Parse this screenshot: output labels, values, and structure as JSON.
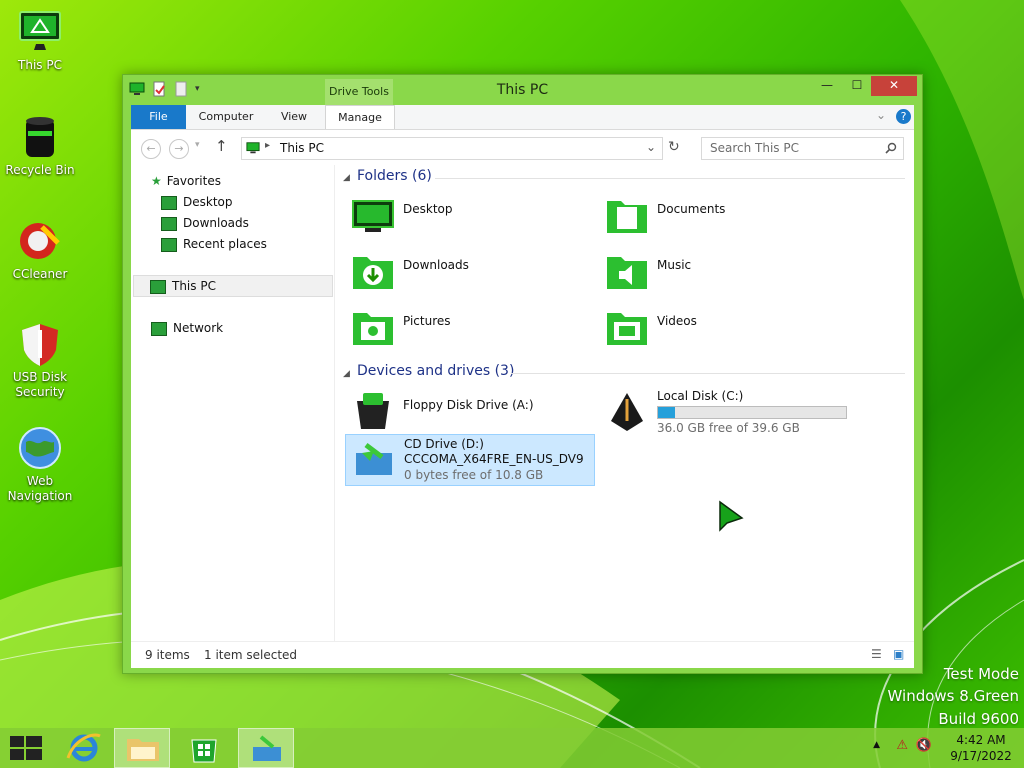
{
  "desktop": {
    "icons": [
      {
        "label": "This PC",
        "icon": "computer-icon"
      },
      {
        "label": "Recycle Bin",
        "icon": "recycle-bin-icon"
      },
      {
        "label": "CCleaner",
        "icon": "ccleaner-icon"
      },
      {
        "label": "USB Disk Security",
        "icon": "shield-icon"
      },
      {
        "label": "Web Navigation",
        "icon": "globe-icon"
      }
    ]
  },
  "window": {
    "title": "This PC",
    "context_tab": "Drive Tools",
    "tabs": {
      "file": "File",
      "computer": "Computer",
      "view": "View",
      "manage": "Manage"
    },
    "controls": {
      "minimize": "—",
      "maximize": "☐",
      "close": "✕"
    },
    "address": {
      "path": "This PC"
    },
    "search": {
      "placeholder": "Search This PC"
    },
    "nav": {
      "favorites": "Favorites",
      "desktop": "Desktop",
      "downloads": "Downloads",
      "recent": "Recent places",
      "this_pc": "This PC",
      "network": "Network"
    },
    "folders_header": "Folders (6)",
    "folders": [
      "Desktop",
      "Documents",
      "Downloads",
      "Music",
      "Pictures",
      "Videos"
    ],
    "devices_header": "Devices and drives (3)",
    "drives": {
      "floppy": "Floppy Disk Drive (A:)",
      "local": {
        "name": "Local Disk (C:)",
        "free": "36.0 GB free of 39.6 GB",
        "used_fraction": 0.09
      },
      "cd": {
        "name": "CD Drive (D:)",
        "label": "CCCOMA_X64FRE_EN-US_DV9",
        "free": "0 bytes free of 10.8 GB"
      }
    },
    "status": {
      "items": "9 items",
      "selected": "1 item selected"
    }
  },
  "watermark": {
    "line1": "Test Mode",
    "line2": "Windows 8.Green",
    "line3": "Build 9600"
  },
  "taskbar": {
    "time": "4:42 AM",
    "date": "9/17/2022"
  },
  "colors": {
    "accent": "#1979ca",
    "window_frame": "#8ad84a",
    "header_text": "#1e3287"
  }
}
